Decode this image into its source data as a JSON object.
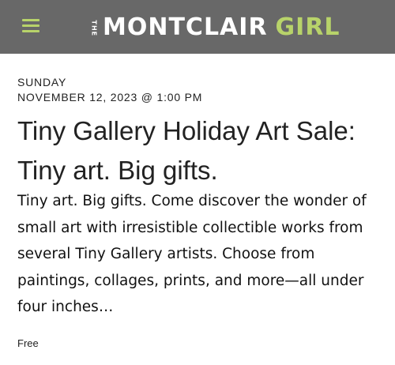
{
  "header": {
    "menu_icon": "hamburger-menu-icon",
    "logo_the": "THE",
    "logo_main": "MONTCLAIR",
    "logo_accent": "GIRL",
    "colors": {
      "bar": "#686868",
      "accent": "#b8d36a"
    }
  },
  "event": {
    "day": "SUNDAY",
    "datetime": "NOVEMBER 12, 2023 @ 1:00 PM",
    "title": "Tiny Gallery Holiday Art Sale: Tiny art. Big gifts.",
    "description": "Tiny art. Big gifts. Come discover the wonder of small art with irresistible collectible works from several Tiny Gallery artists. Choose from paintings, collages, prints, and more—all under four inches…",
    "price": "Free"
  }
}
